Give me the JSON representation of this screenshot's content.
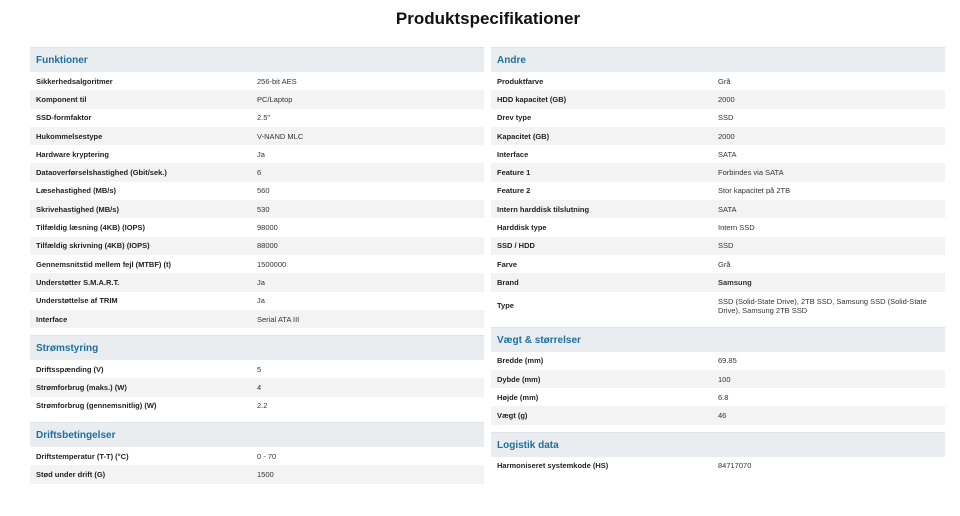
{
  "title": "Produktspecifikationer",
  "left": [
    {
      "heading": "Funktioner",
      "rows": [
        {
          "label": "Sikkerhedsalgoritmer",
          "value": "256-bit AES"
        },
        {
          "label": "Komponent til",
          "value": "PC/Laptop"
        },
        {
          "label": "SSD-formfaktor",
          "value": "2.5\""
        },
        {
          "label": "Hukommelsestype",
          "value": "V-NAND MLC"
        },
        {
          "label": "Hardware kryptering",
          "value": "Ja"
        },
        {
          "label": "Dataoverførselshastighed (Gbit/sek.)",
          "value": "6"
        },
        {
          "label": "Læsehastighed (MB/s)",
          "value": "560"
        },
        {
          "label": "Skrivehastighed (MB/s)",
          "value": "530"
        },
        {
          "label": "Tilfældig læsning (4KB) (IOPS)",
          "value": "98000"
        },
        {
          "label": "Tilfældig skrivning (4KB) (IOPS)",
          "value": "88000"
        },
        {
          "label": "Gennemsnitstid mellem fejl (MTBF) (t)",
          "value": "1500000"
        },
        {
          "label": "Understøtter S.M.A.R.T.",
          "value": "Ja"
        },
        {
          "label": "Understøttelse af TRIM",
          "value": "Ja"
        },
        {
          "label": "Interface",
          "value": "Serial ATA III"
        }
      ]
    },
    {
      "heading": "Strømstyring",
      "rows": [
        {
          "label": "Driftsspænding (V)",
          "value": "5"
        },
        {
          "label": "Strømforbrug (maks.) (W)",
          "value": "4"
        },
        {
          "label": "Strømforbrug (gennemsnitlig) (W)",
          "value": "2.2"
        }
      ]
    },
    {
      "heading": "Driftsbetingelser",
      "rows": [
        {
          "label": "Driftstemperatur (T-T) (°C)",
          "value": "0 - 70"
        },
        {
          "label": "Stød under drift (G)",
          "value": "1500"
        }
      ]
    }
  ],
  "right": [
    {
      "heading": "Andre",
      "rows": [
        {
          "label": "Produktfarve",
          "value": "Grå"
        },
        {
          "label": "HDD kapacitet (GB)",
          "value": "2000"
        },
        {
          "label": "Drev type",
          "value": "SSD"
        },
        {
          "label": "Kapacitet (GB)",
          "value": "2000"
        },
        {
          "label": "Interface",
          "value": "SATA"
        },
        {
          "label": "Feature 1",
          "value": "Forbindes via SATA"
        },
        {
          "label": "Feature 2",
          "value": "Stor kapacitet på 2TB"
        },
        {
          "label": "Intern harddisk tilslutning",
          "value": "SATA"
        },
        {
          "label": "Harddisk type",
          "value": "Intern SSD"
        },
        {
          "label": "SSD / HDD",
          "value": "SSD"
        },
        {
          "label": "Farve",
          "value": "Grå"
        },
        {
          "label": "Brand",
          "value": "Samsung",
          "bold": true
        },
        {
          "label": "Type",
          "value": "SSD (Solid-State Drive), 2TB SSD, Samsung SSD (Solid-State Drive), Samsung 2TB SSD",
          "tall": true
        }
      ]
    },
    {
      "heading": "Vægt & størrelser",
      "rows": [
        {
          "label": "Bredde (mm)",
          "value": "69.85"
        },
        {
          "label": "Dybde (mm)",
          "value": "100"
        },
        {
          "label": "Højde (mm)",
          "value": "6.8"
        },
        {
          "label": "Vægt (g)",
          "value": "46"
        }
      ]
    },
    {
      "heading": "Logistik data",
      "rows": [
        {
          "label": "Harmoniseret systemkode (HS)",
          "value": "84717070"
        }
      ]
    }
  ]
}
